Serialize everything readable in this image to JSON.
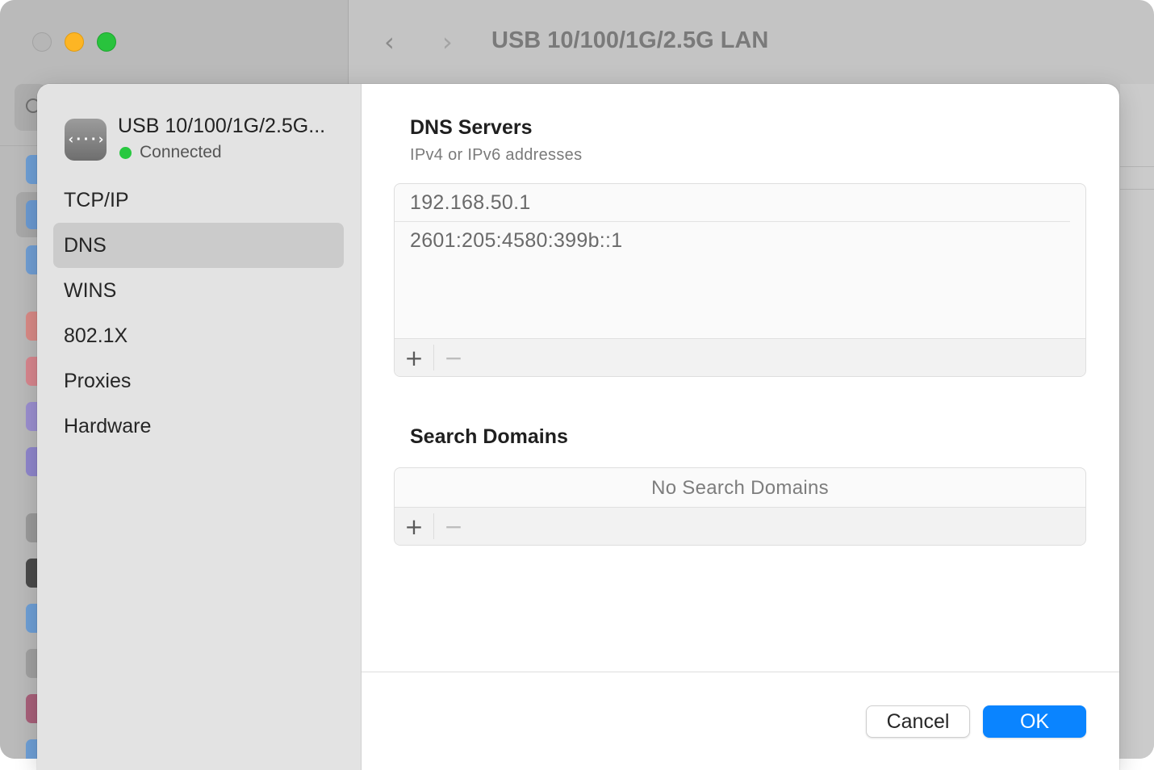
{
  "window": {
    "title": "USB 10/100/1G/2.5G LAN",
    "nav_back_glyph": "‹",
    "nav_forward_glyph": "›"
  },
  "sheet": {
    "device": {
      "name": "USB 10/100/1G/2.5G...",
      "status": "Connected",
      "status_color": "#28c840",
      "icon": "ethernet-icon",
      "icon_glyph": "‹···›"
    },
    "nav_items": [
      "TCP/IP",
      "DNS",
      "WINS",
      "802.1X",
      "Proxies",
      "Hardware"
    ],
    "selected_nav": "DNS",
    "dns": {
      "title": "DNS Servers",
      "subtitle": "IPv4 or IPv6 addresses",
      "servers": [
        "192.168.50.1",
        "2601:205:4580:399b::1"
      ]
    },
    "search_domains": {
      "title": "Search Domains",
      "empty_text": "No Search Domains"
    },
    "toolbar": {
      "add_glyph": "+",
      "remove_glyph": "−"
    },
    "buttons": {
      "cancel": "Cancel",
      "ok": "OK"
    }
  },
  "colors": {
    "accent": "#0a84ff",
    "sidebar_selected": "#cbcbcb"
  }
}
